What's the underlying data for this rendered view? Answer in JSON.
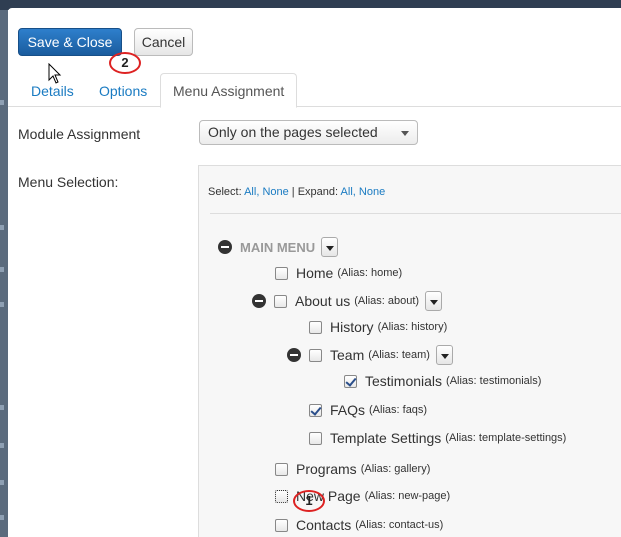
{
  "toolbar": {
    "save_close_label": "Save & Close",
    "cancel_label": "Cancel"
  },
  "tabs": [
    {
      "label": "Details"
    },
    {
      "label": "Options"
    },
    {
      "label": "Menu Assignment"
    }
  ],
  "module_assignment": {
    "label": "Module Assignment",
    "selected": "Only on the pages selected"
  },
  "menu_selection": {
    "label": "Menu Selection:",
    "select_text": "Select:",
    "all": "All,",
    "none": "None",
    "sep": " | ",
    "expand_text": "Expand:",
    "expand_all": "All,",
    "expand_none": "None",
    "root": "MAIN MENU",
    "items": [
      {
        "name": "Home",
        "alias": "(Alias: home)",
        "checked": false
      },
      {
        "name": "About us",
        "alias": "(Alias: about)",
        "checked": false
      },
      {
        "name": "History",
        "alias": "(Alias: history)",
        "checked": false
      },
      {
        "name": "Team",
        "alias": "(Alias: team)",
        "checked": false
      },
      {
        "name": "Testimonials",
        "alias": "(Alias: testimonials)",
        "checked": true
      },
      {
        "name": "FAQs",
        "alias": "(Alias: faqs)",
        "checked": true
      },
      {
        "name": "Template Settings",
        "alias": "(Alias: template-settings)",
        "checked": false
      },
      {
        "name": "Programs",
        "alias": "(Alias: gallery)",
        "checked": false
      },
      {
        "name": "New Page",
        "alias": "(Alias: new-page)",
        "checked": false
      },
      {
        "name": "Contacts",
        "alias": "(Alias: contact-us)",
        "checked": false
      }
    ]
  },
  "callouts": {
    "one": "1",
    "two": "2"
  },
  "colors": {
    "primary": "#1a5c9e",
    "link": "#1a7bc2",
    "callout": "#dd2222"
  }
}
